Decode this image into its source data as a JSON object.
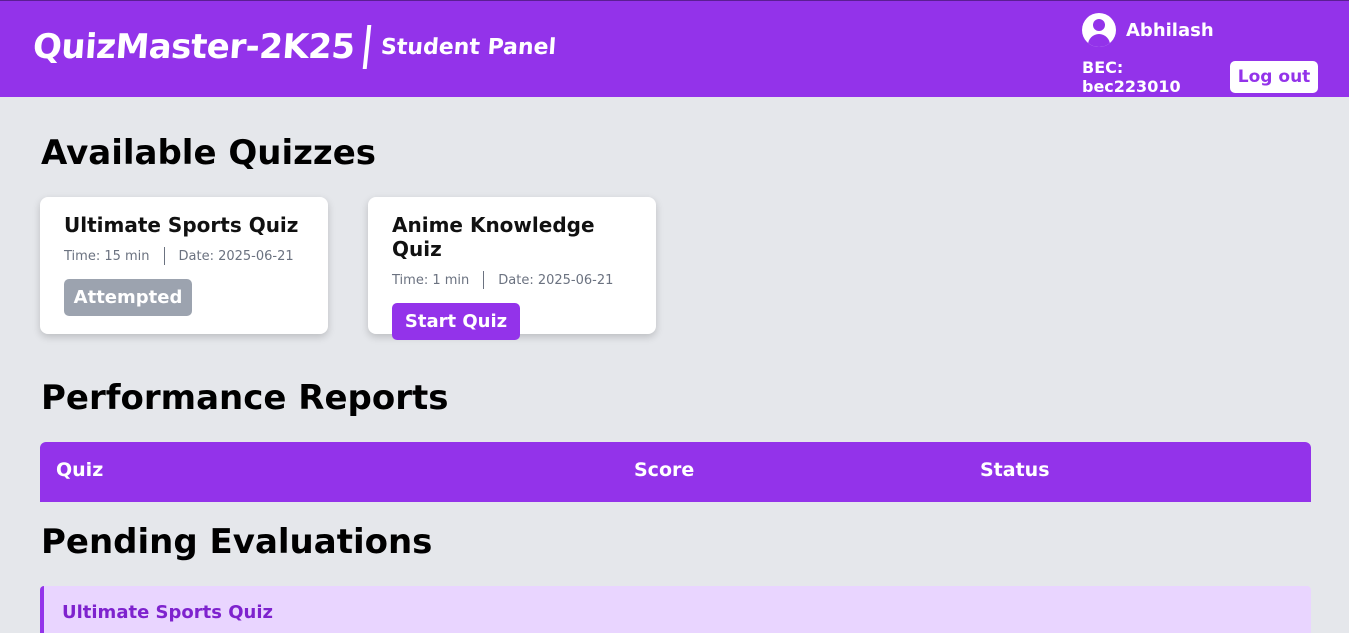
{
  "header": {
    "brand": "QuizMaster-2K25",
    "panel": "Student Panel",
    "username": "Abhilash",
    "bec_label": "BEC: bec223010",
    "logout_label": "Log out"
  },
  "available": {
    "title": "Available Quizzes",
    "quizzes": [
      {
        "name": "Ultimate Sports Quiz",
        "time": "Time: 15 min",
        "date": "Date: 2025-06-21",
        "action": "Attempted"
      },
      {
        "name": "Anime Knowledge Quiz",
        "time": "Time: 1 min",
        "date": "Date: 2025-06-21",
        "action": "Start Quiz"
      }
    ]
  },
  "reports": {
    "title": "Performance Reports",
    "columns": [
      "Quiz",
      "Score",
      "Status"
    ]
  },
  "pending": {
    "title": "Pending Evaluations",
    "items": [
      {
        "name": "Ultimate Sports Quiz",
        "note": ""
      }
    ]
  },
  "colors": {
    "accent": "#9333ea",
    "background": "#e5e7eb",
    "attempted": "#9ca3af",
    "pending_bg": "#e9d5ff"
  },
  "icons": {
    "avatar": "user-circle-icon"
  }
}
